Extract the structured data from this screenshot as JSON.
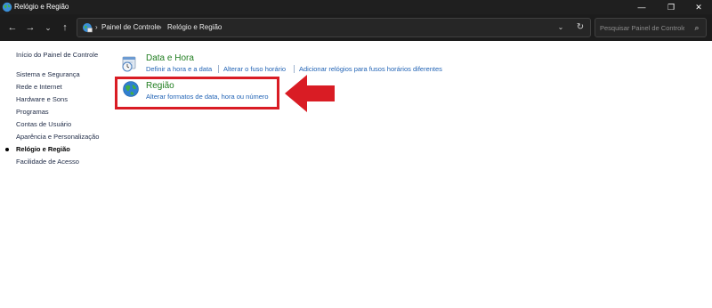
{
  "window": {
    "title": "Relógio e Região",
    "min_glyph": "—",
    "max_glyph": "❐",
    "close_glyph": "✕"
  },
  "nav": {
    "back_icon": "arrow-left-icon",
    "forward_icon": "arrow-right-icon",
    "recent_icon": "chevron-down-icon",
    "up_icon": "arrow-up-icon",
    "back_glyph": "←",
    "forward_glyph": "→",
    "recent_glyph": "⌄",
    "up_glyph": "↑"
  },
  "address": {
    "separator": "›",
    "crumbs": [
      "Painel de Controle",
      "Relógio e Região"
    ],
    "dropdown_glyph": "⌄",
    "refresh_glyph": "↻"
  },
  "search": {
    "placeholder": "Pesquisar Painel de Controle",
    "icon_glyph": "⌕"
  },
  "sidebar": {
    "home": "Início do Painel de Controle",
    "items": [
      {
        "label": "Sistema e Segurança",
        "active": false
      },
      {
        "label": "Rede e Internet",
        "active": false
      },
      {
        "label": "Hardware e Sons",
        "active": false
      },
      {
        "label": "Programas",
        "active": false
      },
      {
        "label": "Contas de Usuário",
        "active": false
      },
      {
        "label": "Aparência e Personalização",
        "active": false
      },
      {
        "label": "Relógio e Região",
        "active": true
      },
      {
        "label": "Facilidade de Acesso",
        "active": false
      }
    ]
  },
  "categories": [
    {
      "title": "Data e Hora",
      "icon": "clock-calendar-icon",
      "links": [
        "Definir a hora e a data",
        "Alterar o fuso horário",
        "Adicionar relógios para fusos horários diferentes"
      ]
    },
    {
      "title": "Região",
      "icon": "globe-icon",
      "links": [
        "Alterar formatos de data, hora ou número"
      ]
    }
  ],
  "colors": {
    "accent_red": "#d91c24",
    "link_blue": "#2163b5",
    "title_green": "#1f7d1f",
    "chrome_dark": "#1c1c1c"
  }
}
